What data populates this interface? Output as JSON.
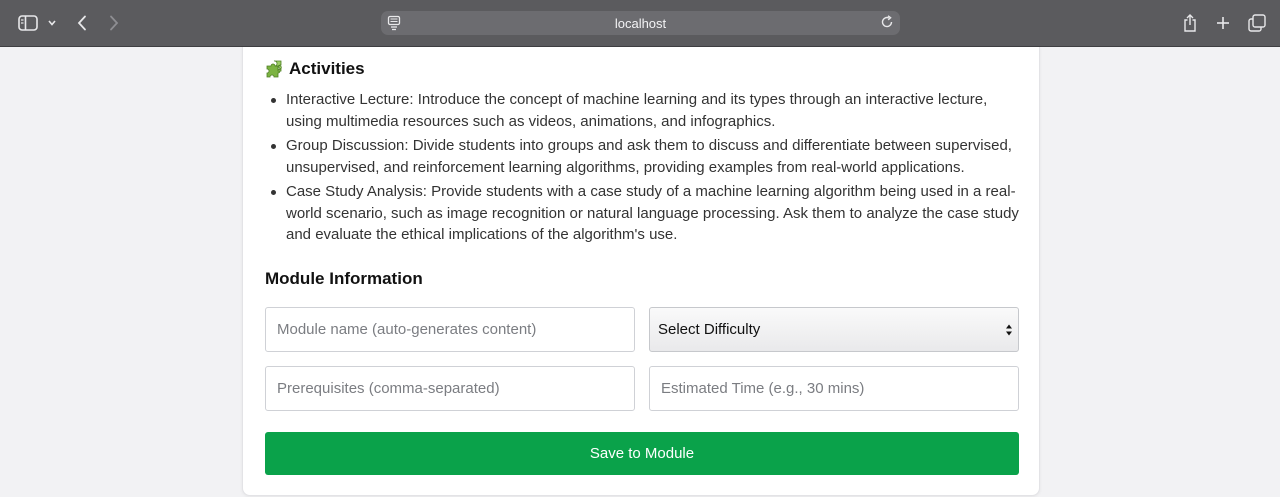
{
  "browser": {
    "url": "localhost",
    "icons": [
      "sidebar-icon",
      "chevron-down-icon",
      "back-icon",
      "forward-icon",
      "site-info-icon",
      "reload-icon",
      "share-icon",
      "new-tab-icon",
      "tabs-overview-icon"
    ]
  },
  "activities": {
    "icon": "puzzle-icon",
    "title": "Activities",
    "items": [
      "Interactive Lecture: Introduce the concept of machine learning and its types through an interactive lecture, using multimedia resources such as videos, animations, and infographics.",
      "Group Discussion: Divide students into groups and ask them to discuss and differentiate between supervised, unsupervised, and reinforcement learning algorithms, providing examples from real-world applications.",
      "Case Study Analysis: Provide students with a case study of a machine learning algorithm being used in a real-world scenario, such as image recognition or natural language processing. Ask them to analyze the case study and evaluate the ethical implications of the algorithm's use."
    ]
  },
  "module": {
    "title": "Module Information",
    "name_placeholder": "Module name (auto-generates content)",
    "difficulty_selected": "Select Difficulty",
    "prerequisites_placeholder": "Prerequisites (comma-separated)",
    "time_placeholder": "Estimated Time (e.g., 30 mins)",
    "save_label": "Save to Module"
  },
  "colors": {
    "toolbar": "#5b5b5e",
    "save_button": "#0aa24a"
  }
}
